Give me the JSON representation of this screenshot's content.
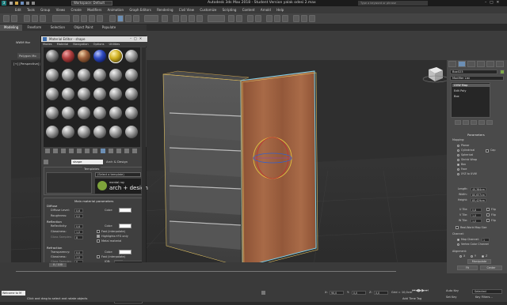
{
  "title": {
    "app_title": "Autodesk 3ds Max 2018 - Student Version    yalak odesi 2.max",
    "workspace": "Workspace: Default",
    "search_placeholder": "Type a keyword or phrase"
  },
  "menu": [
    "Edit",
    "Tools",
    "Group",
    "Views",
    "Create",
    "Modifiers",
    "Animation",
    "Graph Editors",
    "Rendering",
    "Civil View",
    "Customize",
    "Scripting",
    "Content",
    "Arnold",
    "Help"
  ],
  "ribbon_tabs": [
    "Modeling",
    "Freeform",
    "Selection",
    "Object Paint",
    "Populate"
  ],
  "ribbon": {
    "left_panel_label": "Polygon Mo",
    "wwm_label": "WWM Mor"
  },
  "viewport": {
    "label": "[+] [Perspective] [Standard] [Default Shading]"
  },
  "material_editor": {
    "title": "Material Editor - shape",
    "menus": [
      "Modes",
      "Material",
      "Navigation",
      "Options",
      "Utilities"
    ],
    "material_name": "shape",
    "material_type": "Arch & Design",
    "templates": {
      "header": "Templates",
      "select": "(Select a template)",
      "badge_top": "mental ray",
      "badge_main": "arch + design"
    },
    "main_params": {
      "header": "Main material parameters",
      "diffuse": "Diffuse",
      "diffuse_level": "Diffuse Level:",
      "diffuse_level_val": "0,6",
      "roughness": "Roughness:",
      "roughness_val": "0,0",
      "color": "Color:",
      "reflection": "Reflection",
      "reflectivity": "Reflectivity:",
      "reflectivity_val": "0,6",
      "glossiness": "Glossiness:",
      "glossiness_val": "1,0",
      "gloss_samples": "Gloss Samples:",
      "gloss_samples_val": "8",
      "fast_interp": "Fast (interpolate)",
      "highlights": "Highlights+FG only",
      "metal": "Metal material",
      "refraction": "Refraction",
      "transparency": "Transparency:",
      "transparency_val": "0,0",
      "r_glossiness": "Glossiness:",
      "r_glossiness_val": "1,0",
      "r_gloss_samples": "Gloss Samples:",
      "r_gloss_samples_val": "8",
      "r_fast": "Fast (interpolate)",
      "ior": "IOR:",
      "ior_val": "1,4",
      "translucency": "Translucency",
      "weight": "Weight:",
      "weight_val": "0,5",
      "t_color": "Color:",
      "anisotropy": "Anisotropy",
      "aniso_val": "1,0",
      "rotation": "Rotation:",
      "rotation_val": "0,0",
      "automatic": "Automatic",
      "map_channel": "Map Channel:"
    },
    "colors": {
      "diffuse": "#ffffff",
      "reflection": "#ffffff",
      "refraction": "#ffffff",
      "translucency": "#e0c080"
    }
  },
  "command_panel": {
    "object_name": "Box023",
    "modifier_list": "Modifier List",
    "stack": [
      "UVW Map",
      "Edit Poly",
      "Box"
    ],
    "params_header": "Parameters",
    "mapping": "Mapping:",
    "mapping_opts": [
      "Planar",
      "Cylindrical",
      "Cap",
      "Spherical",
      "Shrink Wrap",
      "Box",
      "Face",
      "XYZ to UVW"
    ],
    "length_lbl": "Length:",
    "length_val": "40,384cm",
    "width_lbl": "Width:",
    "width_val": "80,657cm",
    "height_lbl": "Height:",
    "height_val": "85,429cm",
    "utile_lbl": "U Tile:",
    "utile_val": "0,8",
    "vtile_lbl": "V Tile:",
    "vtile_val": "1,0",
    "wtile_lbl": "W Tile:",
    "wtile_val": "1,0",
    "flip": "Flip",
    "realworld": "Real-World Map Size",
    "channel": "Channel:",
    "map_channel": "Map Channel:",
    "map_channel_val": "1",
    "vertex_channel": "Vertex Color Channel",
    "alignment": "Alignment:",
    "align_opts": [
      "X",
      "Y",
      "Z"
    ],
    "manipulate": "Manipulate",
    "fit": "Fit",
    "center": "Center",
    "bitmap_fit": "Bitmap Fit",
    "normal_align": "Normal Align"
  },
  "timeline": {
    "position": "0 / 100"
  },
  "status": {
    "welcome": "Welcome to M",
    "prompt": "Click and drag to select and rotate objects",
    "x_lbl": "X:",
    "x_val": "90,0",
    "y_lbl": "Y:",
    "y_val": "0,0",
    "z_lbl": "Z:",
    "z_val": "0,0",
    "grid": "Grid = 10,0cm",
    "add_time_tag": "Add Time Tag",
    "autokey": "Auto Key",
    "selected": "Selected",
    "setkey": "Set Key",
    "key_filters": "Key Filters..."
  }
}
